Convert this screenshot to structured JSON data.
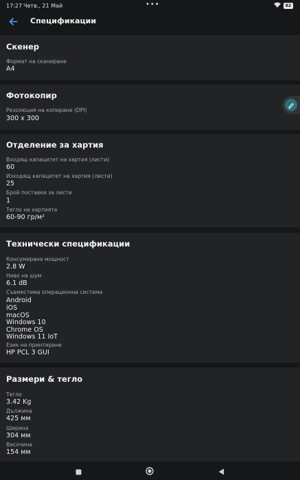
{
  "status_bar": {
    "time": "17:27",
    "date": "Четв., 21 Май",
    "dots": "•••",
    "battery": "82"
  },
  "app_bar": {
    "title": "Спецификации"
  },
  "sections": {
    "scanner": {
      "title": "Скенер",
      "fields": [
        {
          "label": "Формат на сканиране",
          "value": "A4"
        }
      ]
    },
    "copier": {
      "title": "Фотокопир",
      "fields": [
        {
          "label": "Резолюция на копиране (DPI)",
          "value": "300 x 300"
        }
      ]
    },
    "paper": {
      "title": "Отделение за хартия",
      "fields": [
        {
          "label": "Входящ капацитет на хартия (листи)",
          "value": "60"
        },
        {
          "label": "Изходящ капацитет на хартия (листи)",
          "value": "25"
        },
        {
          "label": "Брой поставки за листи",
          "value": "1"
        },
        {
          "label": "Тегло на хартията",
          "value": "60-90 гр/м²"
        }
      ]
    },
    "tech": {
      "title": "Технически спецификации",
      "power_label": "Консумирана мощност",
      "power_value": "2.8 W",
      "noise_label": "Ниво на шум",
      "noise_value": "6.1 dB",
      "os_label": "Съвместима операционна система",
      "os_values": [
        "Android",
        "iOS",
        "macOS",
        "Windows 10",
        "Chrome OS",
        "Windows 11 IoT"
      ],
      "lang_label": "Език на принтиране",
      "lang_value": "HP PCL 3 GUI"
    },
    "dimensions": {
      "title": "Размери & тегло",
      "fields": [
        {
          "label": "Тегло",
          "value": "3.42 Kg"
        },
        {
          "label": "Дължина",
          "value": "425 мм"
        },
        {
          "label": "Ширина",
          "value": "304 мм"
        },
        {
          "label": "Височина",
          "value": "154 мм"
        }
      ]
    }
  },
  "colors": {
    "accent": "#4aa3ff",
    "fab": "#2d6f79",
    "background": "#161718",
    "card": "#222325"
  }
}
